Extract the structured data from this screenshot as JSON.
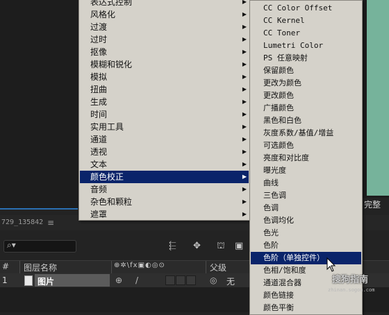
{
  "panel": {
    "title": "729_135842",
    "menu_icon": "≡",
    "right_tab": "完整"
  },
  "toolbar": {
    "search_icon": "⌕▾",
    "icons": [
      "⬱",
      "✥",
      "⛫",
      "▣"
    ]
  },
  "columns": {
    "num": "#",
    "layer_name": "图层名称",
    "switches": "⊕✲\\fx▣◐◎⊙",
    "parent": "父级"
  },
  "layer": {
    "num": "1",
    "name": "图片",
    "sw1": "⊕",
    "sw2": "/",
    "parent_icon": "◎",
    "parent_value": "无"
  },
  "effect_menu": {
    "items": [
      {
        "label": "表达式控制",
        "has_submenu": true
      },
      {
        "label": "风格化",
        "has_submenu": true
      },
      {
        "label": "过渡",
        "has_submenu": true
      },
      {
        "label": "过时",
        "has_submenu": true
      },
      {
        "label": "抠像",
        "has_submenu": true
      },
      {
        "label": "模糊和锐化",
        "has_submenu": true
      },
      {
        "label": "模拟",
        "has_submenu": true
      },
      {
        "label": "扭曲",
        "has_submenu": true
      },
      {
        "label": "生成",
        "has_submenu": true
      },
      {
        "label": "时间",
        "has_submenu": true
      },
      {
        "label": "实用工具",
        "has_submenu": true
      },
      {
        "label": "通道",
        "has_submenu": true
      },
      {
        "label": "透视",
        "has_submenu": true
      },
      {
        "label": "文本",
        "has_submenu": true
      },
      {
        "label": "颜色校正",
        "has_submenu": true,
        "selected": true
      },
      {
        "label": "音频",
        "has_submenu": true
      },
      {
        "label": "杂色和颗粒",
        "has_submenu": true
      },
      {
        "label": "遮罩",
        "has_submenu": true
      }
    ]
  },
  "color_submenu": {
    "items": [
      {
        "label": "CC Color Offset"
      },
      {
        "label": "CC Kernel"
      },
      {
        "label": "CC Toner"
      },
      {
        "label": "Lumetri Color"
      },
      {
        "label": "PS 任意映射"
      },
      {
        "label": "保留颜色"
      },
      {
        "label": "更改为颜色"
      },
      {
        "label": "更改颜色"
      },
      {
        "label": "广播颜色"
      },
      {
        "label": "黑色和白色"
      },
      {
        "label": "灰度系数/基值/增益"
      },
      {
        "label": "可选颜色"
      },
      {
        "label": "亮度和对比度"
      },
      {
        "label": "曝光度"
      },
      {
        "label": "曲线"
      },
      {
        "label": "三色调"
      },
      {
        "label": "色调"
      },
      {
        "label": "色调均化"
      },
      {
        "label": "色光"
      },
      {
        "label": "色阶"
      },
      {
        "label": "色阶（单独控件）",
        "selected": true
      },
      {
        "label": "色相/饱和度"
      },
      {
        "label": "通道混合器"
      },
      {
        "label": "颜色链接"
      },
      {
        "label": "颜色平衡"
      }
    ]
  },
  "watermark": {
    "text": "搜狗指南",
    "sub": "zhinan.sogou.com"
  },
  "colors": {
    "menu_bg": "#d5d2ca",
    "menu_selected": "#0a246a",
    "app_bg": "#232323",
    "viewer": "#76b39b"
  }
}
